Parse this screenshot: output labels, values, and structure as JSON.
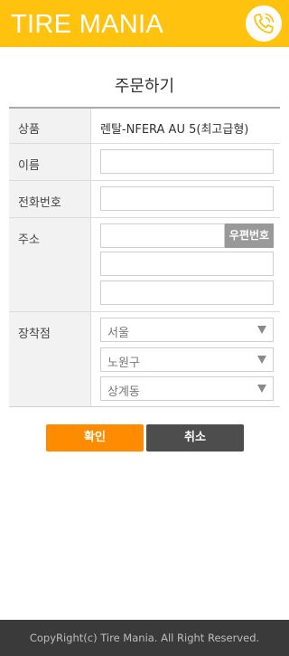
{
  "header": {
    "brand": "TIRE MANIA",
    "phone_icon": "phone-icon",
    "accent_color": "#ffc20e"
  },
  "page": {
    "title": "주문하기"
  },
  "form": {
    "product": {
      "label": "상품",
      "value": "렌탈-NFERA AU 5(최고급형)"
    },
    "name": {
      "label": "이름",
      "value": ""
    },
    "phone": {
      "label": "전화번호",
      "value": ""
    },
    "address": {
      "label": "주소",
      "zip_button": "우편번호",
      "line1": "",
      "line2": "",
      "line3": ""
    },
    "install_shop": {
      "label": "장착점",
      "city": "서울",
      "district": "노원구",
      "dong": "상계동"
    }
  },
  "buttons": {
    "confirm": "확인",
    "cancel": "취소",
    "confirm_color": "#ff8c00",
    "cancel_color": "#4d4d4d"
  },
  "footer": {
    "copyright": "CopyRight(c) Tire Mania. All Right Reserved."
  }
}
